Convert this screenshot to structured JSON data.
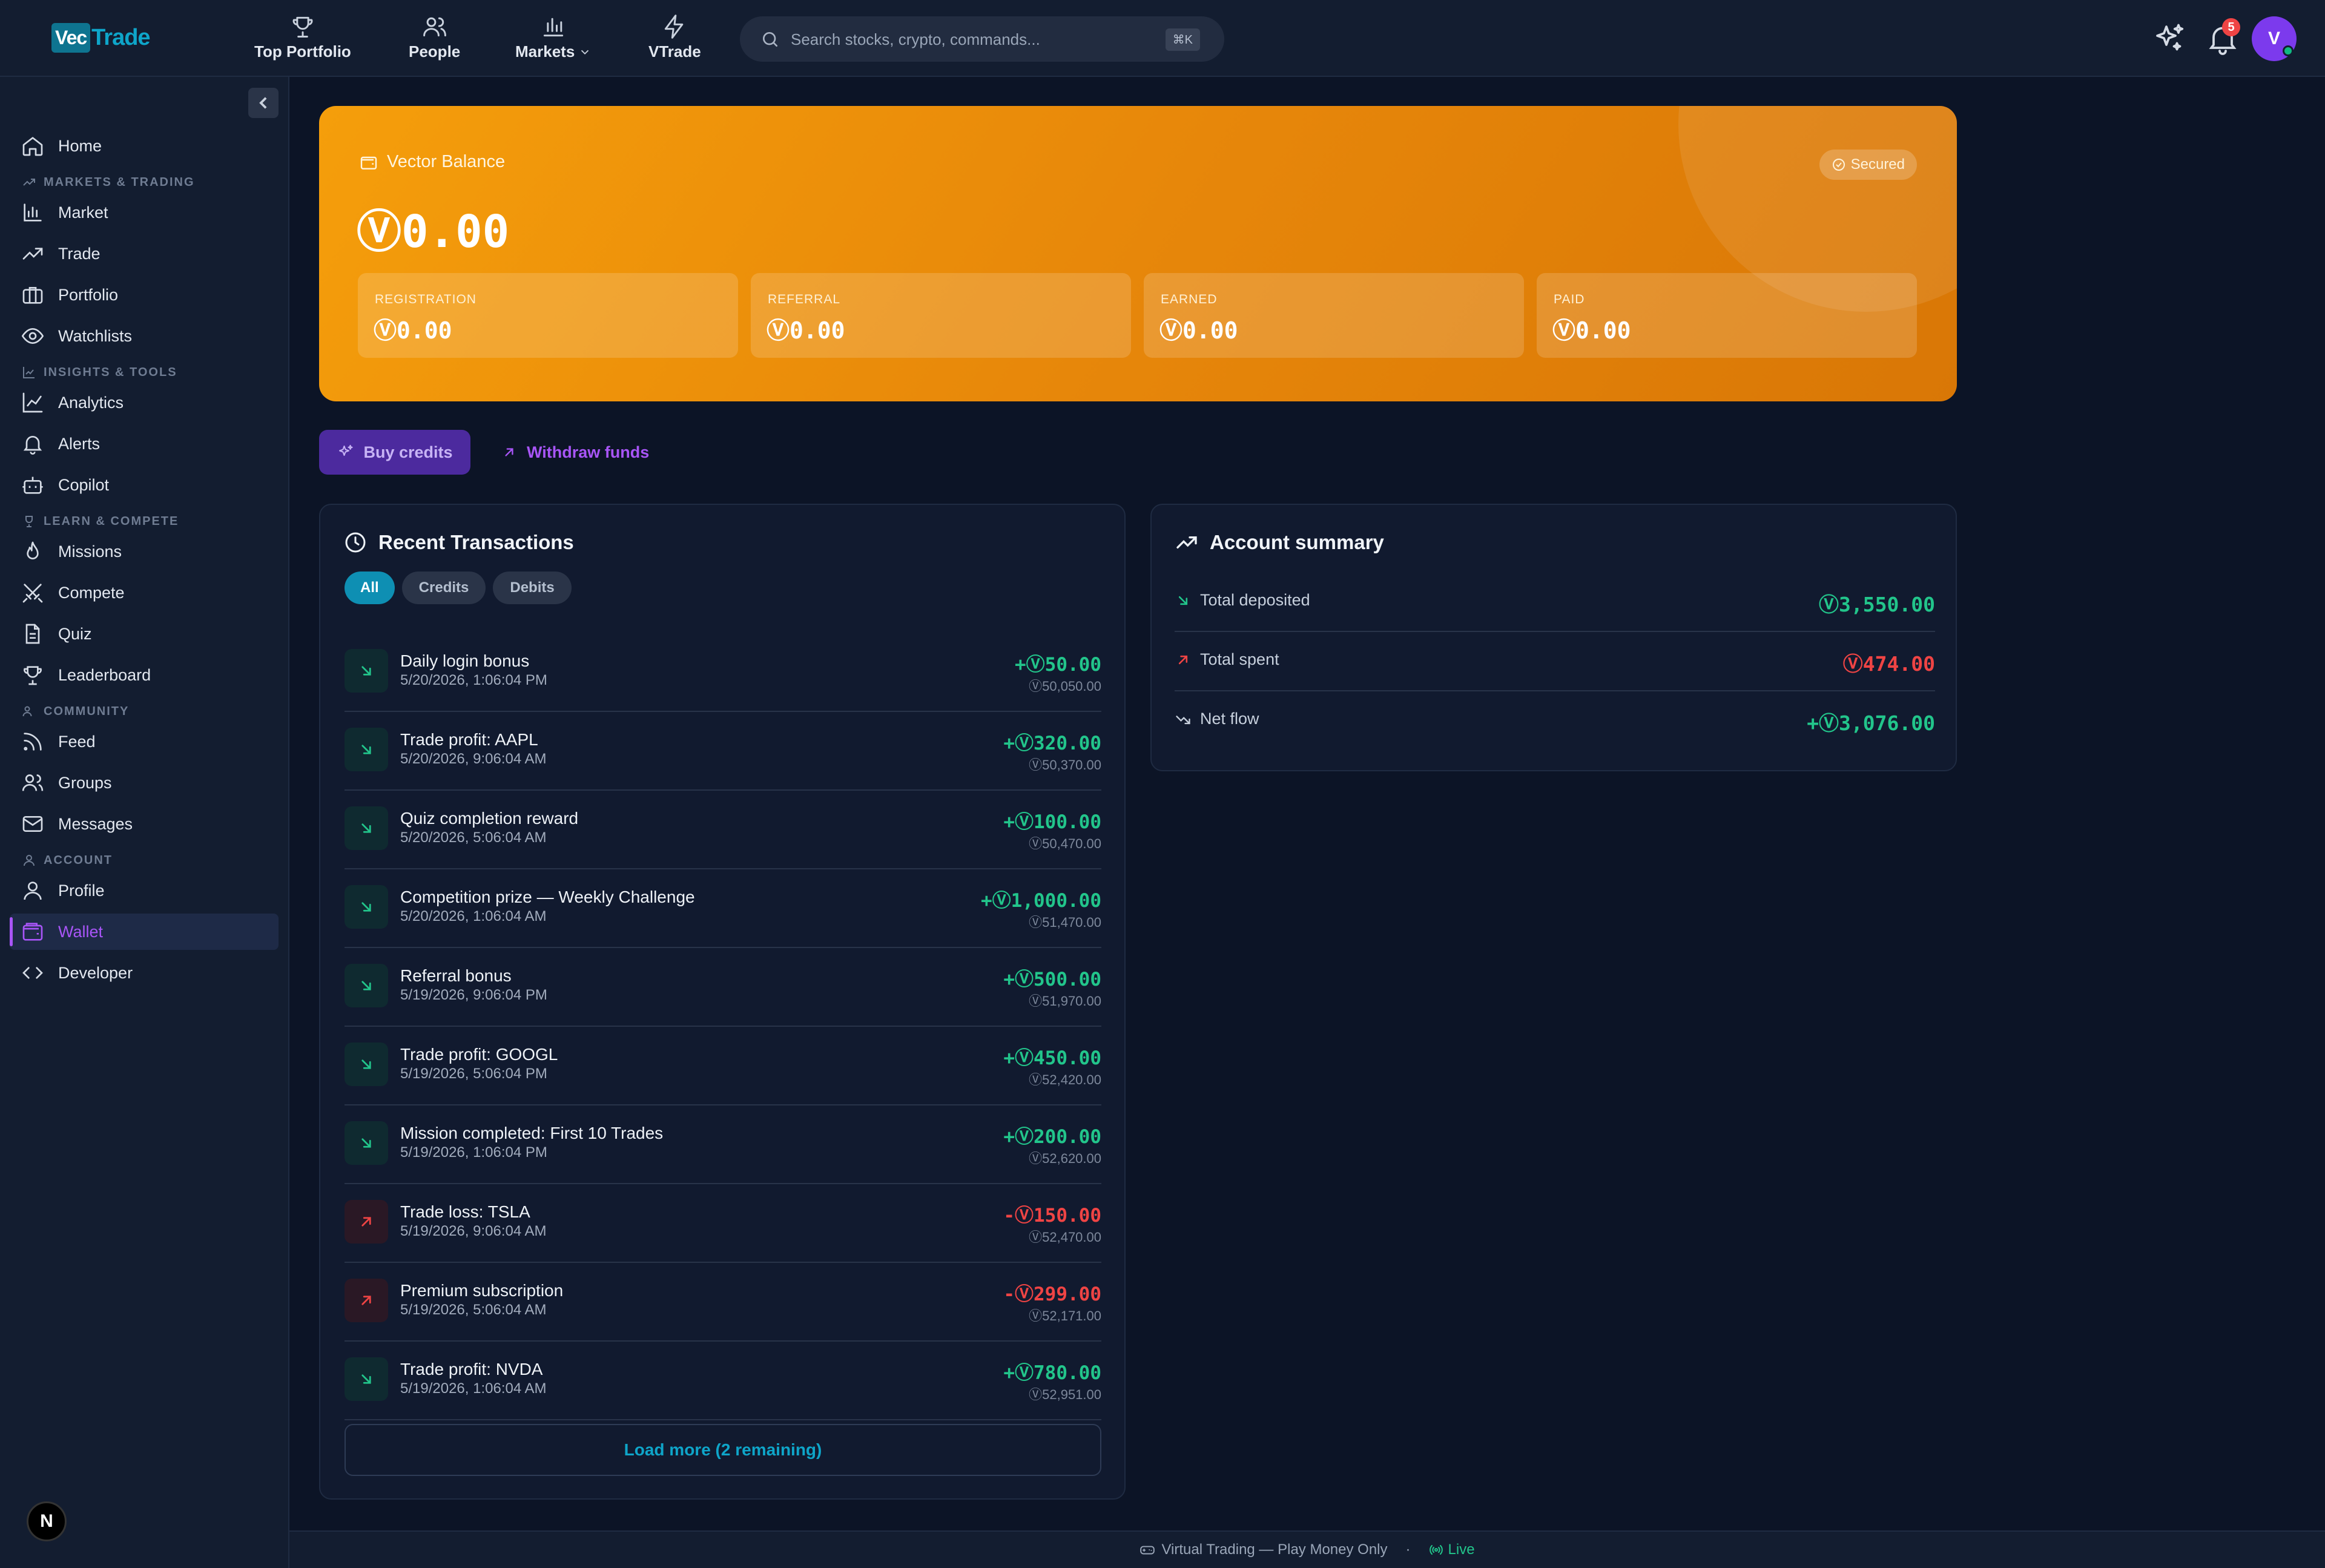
{
  "brand": {
    "logo_part1": "Vec",
    "logo_part2": "Trade"
  },
  "topnav": {
    "items": [
      {
        "label": "Top Portfolio",
        "icon": "trophy-icon"
      },
      {
        "label": "People",
        "icon": "people-icon"
      },
      {
        "label": "Markets",
        "icon": "bar-chart-icon"
      },
      {
        "label": "VTrade",
        "icon": "lightning-icon"
      }
    ],
    "search_placeholder": "Search stocks, crypto, commands...",
    "search_shortcut": "⌘K",
    "notification_count": "5",
    "avatar_initial": "V"
  },
  "sidebar": {
    "home": "Home",
    "sections": {
      "markets": "MARKETS & TRADING",
      "insights": "INSIGHTS & TOOLS",
      "learn": "LEARN & COMPETE",
      "community": "COMMUNITY",
      "account": "ACCOUNT"
    },
    "items": {
      "market": "Market",
      "trade": "Trade",
      "portfolio": "Portfolio",
      "watchlists": "Watchlists",
      "analytics": "Analytics",
      "alerts": "Alerts",
      "copilot": "Copilot",
      "missions": "Missions",
      "compete": "Compete",
      "quiz": "Quiz",
      "leaderboard": "Leaderboard",
      "feed": "Feed",
      "groups": "Groups",
      "messages": "Messages",
      "profile": "Profile",
      "wallet": "Wallet",
      "developer": "Developer"
    },
    "active": "wallet",
    "footer_badge": "N"
  },
  "balance": {
    "label": "Vector Balance",
    "amount": "Ⓥ0.00",
    "secured": "Secured",
    "boxes": [
      {
        "label": "REGISTRATION",
        "value": "Ⓥ0.00"
      },
      {
        "label": "REFERRAL",
        "value": "Ⓥ0.00"
      },
      {
        "label": "EARNED",
        "value": "Ⓥ0.00"
      },
      {
        "label": "PAID",
        "value": "Ⓥ0.00"
      }
    ]
  },
  "actions": {
    "buy": "Buy credits",
    "withdraw": "Withdraw funds"
  },
  "transactions": {
    "title": "Recent Transactions",
    "filters": [
      "All",
      "Credits",
      "Debits"
    ],
    "active_filter": "All",
    "items": [
      {
        "title": "Daily login bonus",
        "date": "5/20/2026, 1:06:04 PM",
        "amount": "+Ⓥ50.00",
        "balance": "Ⓥ50,050.00",
        "type": "credit"
      },
      {
        "title": "Trade profit: AAPL",
        "date": "5/20/2026, 9:06:04 AM",
        "amount": "+Ⓥ320.00",
        "balance": "Ⓥ50,370.00",
        "type": "credit"
      },
      {
        "title": "Quiz completion reward",
        "date": "5/20/2026, 5:06:04 AM",
        "amount": "+Ⓥ100.00",
        "balance": "Ⓥ50,470.00",
        "type": "credit"
      },
      {
        "title": "Competition prize — Weekly Challenge",
        "date": "5/20/2026, 1:06:04 AM",
        "amount": "+Ⓥ1,000.00",
        "balance": "Ⓥ51,470.00",
        "type": "credit"
      },
      {
        "title": "Referral bonus",
        "date": "5/19/2026, 9:06:04 PM",
        "amount": "+Ⓥ500.00",
        "balance": "Ⓥ51,970.00",
        "type": "credit"
      },
      {
        "title": "Trade profit: GOOGL",
        "date": "5/19/2026, 5:06:04 PM",
        "amount": "+Ⓥ450.00",
        "balance": "Ⓥ52,420.00",
        "type": "credit"
      },
      {
        "title": "Mission completed: First 10 Trades",
        "date": "5/19/2026, 1:06:04 PM",
        "amount": "+Ⓥ200.00",
        "balance": "Ⓥ52,620.00",
        "type": "credit"
      },
      {
        "title": "Trade loss: TSLA",
        "date": "5/19/2026, 9:06:04 AM",
        "amount": "-Ⓥ150.00",
        "balance": "Ⓥ52,470.00",
        "type": "debit"
      },
      {
        "title": "Premium subscription",
        "date": "5/19/2026, 5:06:04 AM",
        "amount": "-Ⓥ299.00",
        "balance": "Ⓥ52,171.00",
        "type": "debit"
      },
      {
        "title": "Trade profit: NVDA",
        "date": "5/19/2026, 1:06:04 AM",
        "amount": "+Ⓥ780.00",
        "balance": "Ⓥ52,951.00",
        "type": "credit"
      }
    ],
    "load_more": "Load more (2 remaining)"
  },
  "summary": {
    "title": "Account summary",
    "rows": [
      {
        "label": "Total deposited",
        "value": "Ⓥ3,550.00",
        "color": "#22c58b"
      },
      {
        "label": "Total spent",
        "value": "Ⓥ474.00",
        "color": "#ef4444"
      },
      {
        "label": "Net flow",
        "value": "+Ⓥ3,076.00",
        "color": "#22c58b"
      }
    ]
  },
  "footer": {
    "text": "Virtual Trading — Play Money Only",
    "separator": "·",
    "status": "Live"
  },
  "colors": {
    "accent": "#a855f7",
    "cyan": "#0ea5c9",
    "positive": "#22c58b",
    "negative": "#ef4444",
    "balance_card": "#f59e0b"
  }
}
